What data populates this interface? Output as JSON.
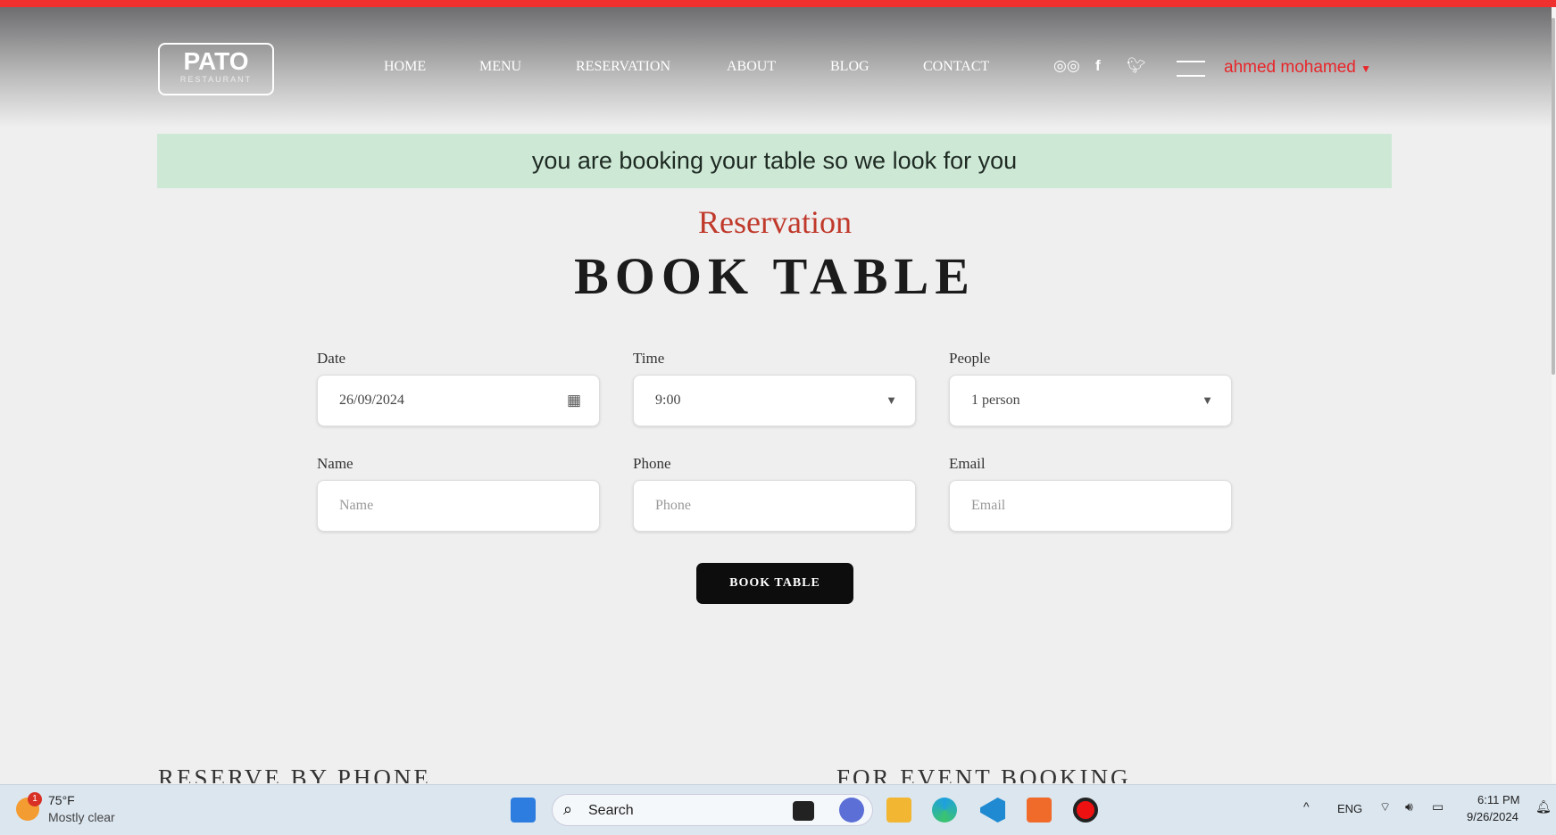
{
  "header": {
    "logo_title": "PATO",
    "logo_sub": "RESTAURANT",
    "nav": [
      "HOME",
      "MENU",
      "RESERVATION",
      "ABOUT",
      "BLOG",
      "CONTACT"
    ],
    "social": [
      "tripadvisor-icon",
      "facebook-icon",
      "twitter-icon"
    ],
    "user": "ahmed mohamed"
  },
  "alert": "you are booking your table so we look for you",
  "section": {
    "subtitle": "Reservation",
    "title": "BOOK TABLE"
  },
  "form": {
    "date": {
      "label": "Date",
      "value": "26/09/2024"
    },
    "time": {
      "label": "Time",
      "value": "9:00"
    },
    "people": {
      "label": "People",
      "value": "1 person"
    },
    "name": {
      "label": "Name",
      "placeholder": "Name"
    },
    "phone": {
      "label": "Phone",
      "placeholder": "Phone"
    },
    "email": {
      "label": "Email",
      "placeholder": "Email"
    },
    "submit": "BOOK TABLE"
  },
  "bottom": {
    "left": "RESERVE BY PHONE",
    "right": "FOR EVENT BOOKING"
  },
  "taskbar": {
    "weather_temp": "75°F",
    "weather_desc": "Mostly clear",
    "badge": "1",
    "search": "Search",
    "lang": "ENG",
    "time": "6:11 PM",
    "date": "9/26/2024"
  },
  "colors": {
    "accent": "#e8262a",
    "alert_bg": "#cde9d6",
    "button": "#0d0d0d"
  }
}
